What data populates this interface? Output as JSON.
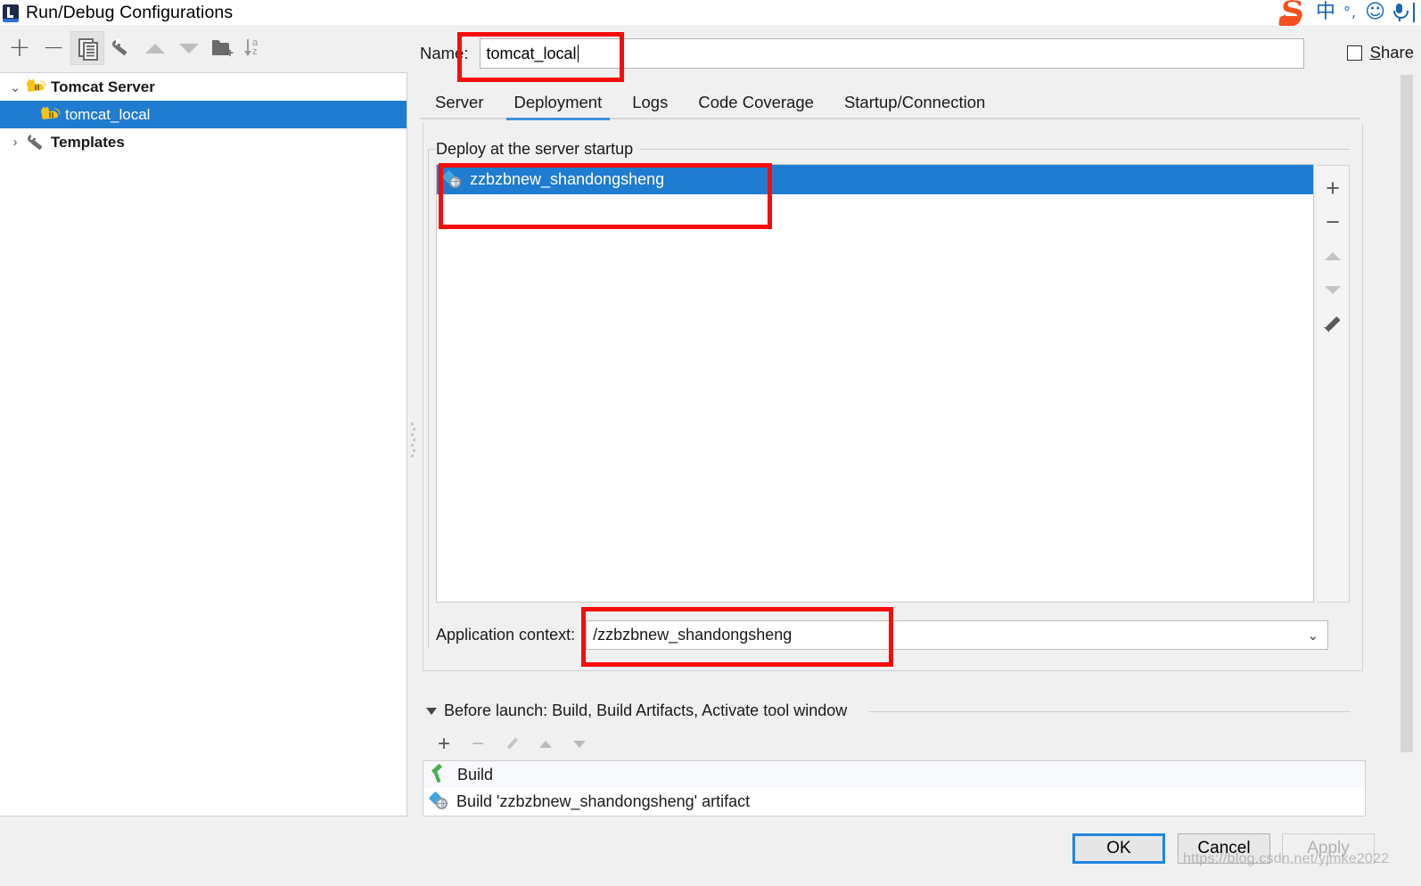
{
  "window": {
    "title": "Run/Debug Configurations",
    "icon": "intellij-run-config-icon"
  },
  "ime": {
    "logo": "sogou-logo",
    "mode": "中",
    "punctuation": "°,",
    "emoji": "☺",
    "mic": "microphone-icon"
  },
  "left_panel": {
    "toolbar": [
      {
        "name": "add",
        "icon": "plus-icon",
        "label": "+",
        "enabled": true
      },
      {
        "name": "remove",
        "icon": "minus-icon",
        "label": "−",
        "enabled": true
      },
      {
        "name": "copy",
        "icon": "copy-icon",
        "label": "",
        "enabled": true,
        "pressed": true
      },
      {
        "name": "edit-templates",
        "icon": "wrench-icon",
        "label": "",
        "enabled": true
      },
      {
        "name": "move-up",
        "icon": "triangle-up-icon",
        "label": "",
        "enabled": false
      },
      {
        "name": "move-down",
        "icon": "triangle-down-icon",
        "label": "",
        "enabled": false
      },
      {
        "name": "new-folder",
        "icon": "folder-plus-icon",
        "label": "",
        "enabled": true
      },
      {
        "name": "sort-alphabetically",
        "icon": "sort-az-icon",
        "label": "",
        "enabled": false
      }
    ],
    "tree": [
      {
        "label": "Tomcat Server",
        "icon": "tomcat-icon",
        "arrow": "⌄",
        "level": 0,
        "bold": true,
        "selected": false
      },
      {
        "label": "tomcat_local",
        "icon": "tomcat-icon",
        "arrow": "",
        "level": 1,
        "bold": false,
        "selected": true
      },
      {
        "label": "Templates",
        "icon": "wrench-icon",
        "arrow": "›",
        "level": 0,
        "bold": true,
        "selected": false
      }
    ]
  },
  "name_field": {
    "label": "Name:",
    "value": "tomcat_local"
  },
  "share": {
    "label_before": "",
    "label_mnemonic": "S",
    "label_after": "hare",
    "checked": false
  },
  "tabs": [
    {
      "label": "Server",
      "active": false
    },
    {
      "label": "Deployment",
      "active": true
    },
    {
      "label": "Logs",
      "active": false
    },
    {
      "label": "Code Coverage",
      "active": false
    },
    {
      "label": "Startup/Connection",
      "active": false
    }
  ],
  "deployment": {
    "group_title": "Deploy at the server startup",
    "items": [
      {
        "label": "zzbzbnew_shandongsheng",
        "icon": "artifact-icon",
        "selected": true
      }
    ],
    "side_toolbar": [
      {
        "name": "add-artifact",
        "icon": "plus-icon",
        "label": "+",
        "enabled": true
      },
      {
        "name": "remove-artifact",
        "icon": "minus-icon",
        "label": "−",
        "enabled": true
      },
      {
        "name": "move-up",
        "icon": "triangle-up-icon",
        "label": "",
        "enabled": false
      },
      {
        "name": "move-down",
        "icon": "triangle-down-icon",
        "label": "",
        "enabled": false
      },
      {
        "name": "edit-artifact",
        "icon": "pencil-icon",
        "label": "",
        "enabled": true
      }
    ]
  },
  "application_context": {
    "label": "Application context:",
    "value": "/zzbzbnew_shandongsheng",
    "chevron": "⌄"
  },
  "before_launch": {
    "header": "Before launch: Build, Build Artifacts, Activate tool window",
    "toolbar": [
      {
        "name": "add-task",
        "icon": "plus-icon",
        "label": "+",
        "enabled": true
      },
      {
        "name": "remove-task",
        "icon": "minus-icon",
        "label": "−",
        "enabled": false
      },
      {
        "name": "edit-task",
        "icon": "pencil-icon",
        "label": "",
        "enabled": false
      },
      {
        "name": "move-task-up",
        "icon": "triangle-up-icon",
        "label": "",
        "enabled": false
      },
      {
        "name": "move-task-down",
        "icon": "triangle-down-icon",
        "label": "",
        "enabled": false
      }
    ],
    "tasks": [
      {
        "label": "Build",
        "icon": "hammer-icon"
      },
      {
        "label": "Build 'zzbzbnew_shandongsheng' artifact",
        "icon": "artifact-icon"
      }
    ]
  },
  "footer": {
    "help": "?",
    "ok": "OK",
    "cancel": "Cancel",
    "apply": "Apply",
    "watermark": "https://blog.csdn.net/yjmke2022"
  },
  "colors": {
    "selection_blue": "#1f7cd0",
    "tab_accent": "#3f91dd",
    "annotation_red": "#fb0a0a",
    "help_blue": "#1a86d8",
    "window_bg": "#f0f0f0"
  }
}
